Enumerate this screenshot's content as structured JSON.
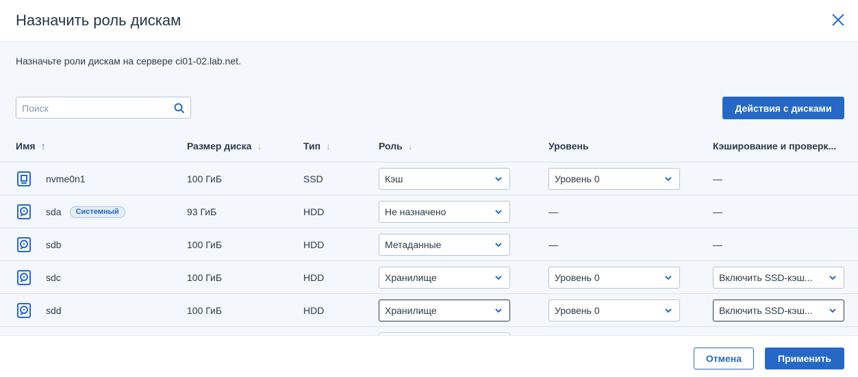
{
  "dialog": {
    "title": "Назначить роль дискам",
    "description": "Назначьте роли дискам на сервере ci01-02.lab.net."
  },
  "search": {
    "placeholder": "Поиск",
    "value": ""
  },
  "actions_button": "Действия с дисками",
  "columns": {
    "name": "Имя",
    "size": "Размер диска",
    "type": "Тип",
    "role": "Роль",
    "tier": "Уровень",
    "caching": "Кэширование и проверк..."
  },
  "sort_arrows": {
    "up": "↑",
    "down": "↓"
  },
  "rows": [
    {
      "icon": "ssd-icon",
      "name": "nvme0n1",
      "badge": "",
      "size": "100 ГиБ",
      "type": "SSD",
      "role": "Кэш",
      "tier": "Уровень 0",
      "caching": "—"
    },
    {
      "icon": "hdd-icon",
      "name": "sda",
      "badge": "Системный",
      "size": "93 ГиБ",
      "type": "HDD",
      "role": "Не назначено",
      "tier": "—",
      "caching": "—"
    },
    {
      "icon": "hdd-icon",
      "name": "sdb",
      "badge": "",
      "size": "100 ГиБ",
      "type": "HDD",
      "role": "Метаданные",
      "tier": "—",
      "caching": "—"
    },
    {
      "icon": "hdd-icon",
      "name": "sdc",
      "badge": "",
      "size": "100 ГиБ",
      "type": "HDD",
      "role": "Хранилище",
      "tier": "Уровень 0",
      "caching": "Включить SSD-кэш..."
    },
    {
      "icon": "hdd-icon",
      "name": "sdd",
      "badge": "",
      "size": "100 ГиБ",
      "type": "HDD",
      "role": "Хранилище",
      "tier": "Уровень 0",
      "caching": "Включить SSD-кэш..."
    }
  ],
  "footer": {
    "cancel": "Отмена",
    "apply": "Применить"
  },
  "colors": {
    "accent": "#2668c5",
    "background": "#f4f7fb",
    "text": "#2b3a4a"
  }
}
